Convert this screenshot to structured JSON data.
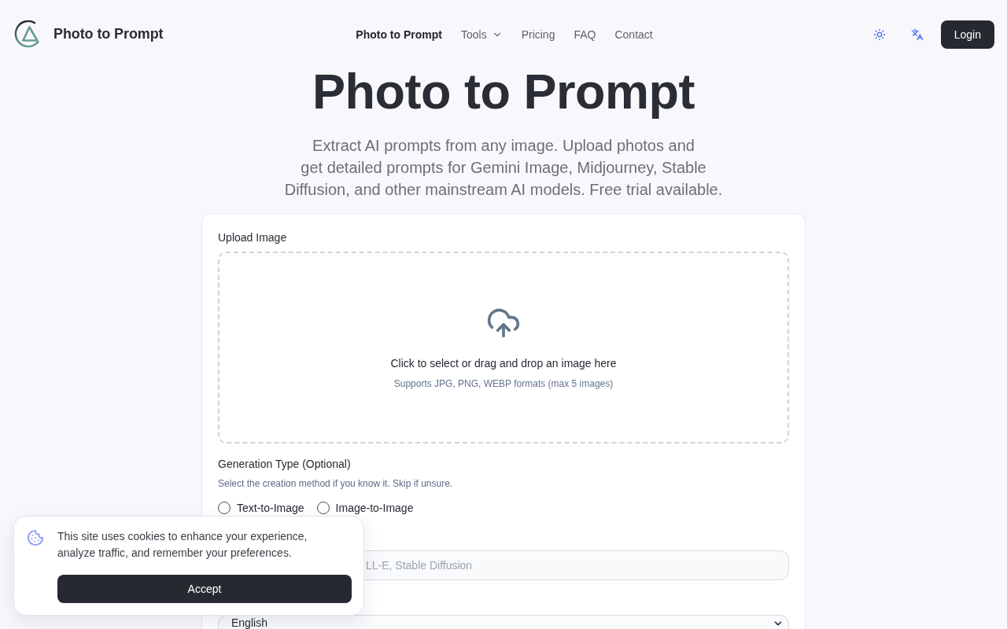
{
  "header": {
    "brand": "Photo to Prompt",
    "nav": [
      {
        "label": "Photo to Prompt",
        "kind": "link",
        "selected": true
      },
      {
        "label": "Tools",
        "kind": "dropdown",
        "selected": false
      },
      {
        "label": "Pricing",
        "kind": "link",
        "selected": false
      },
      {
        "label": "FAQ",
        "kind": "link",
        "selected": false
      },
      {
        "label": "Contact",
        "kind": "link",
        "selected": false
      }
    ],
    "login_button": "Login"
  },
  "hero": {
    "title": "Photo to Prompt",
    "subtitle": "Extract AI prompts from any image. Upload photos and get detailed prompts for Gemini Image, Midjourney, Stable Diffusion, and other mainstream AI models. Free trial available."
  },
  "form": {
    "upload": {
      "label": "Upload Image",
      "prompt": "Click to select or drag and drop an image here",
      "hint": "Supports JPG, PNG, WEBP formats (max 5 images)"
    },
    "generation_type": {
      "label": "Generation Type (Optional)",
      "hint": "Select the creation method if you know it. Skip if unsure.",
      "options": [
        {
          "label": "Text-to-Image",
          "selected": false
        },
        {
          "label": "Image-to-Image",
          "selected": false
        }
      ]
    },
    "model_field": {
      "placeholder": "LL-E, Stable Diffusion"
    },
    "language_select": {
      "value": "English"
    }
  },
  "cookie_banner": {
    "message": "This site uses cookies to enhance your experience, analyze traffic, and remember your preferences.",
    "accept_button": "Accept"
  }
}
